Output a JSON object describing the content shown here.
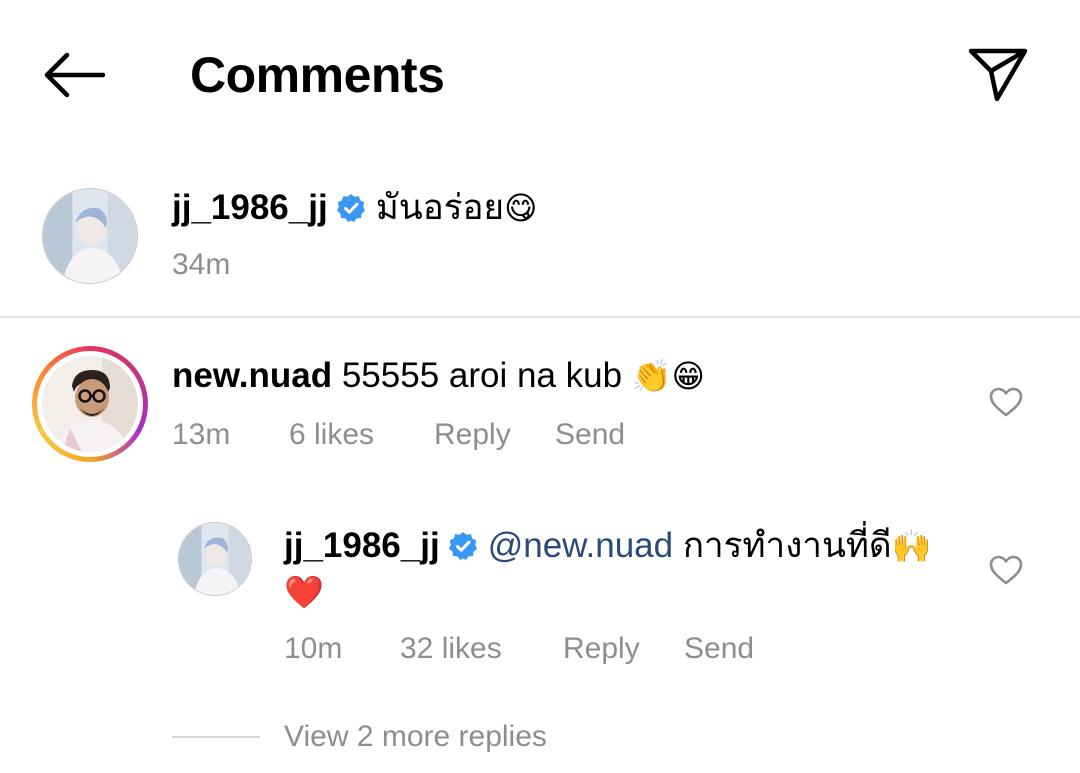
{
  "header": {
    "title": "Comments",
    "back_icon": "arrow-left-icon",
    "send_icon": "paper-plane-icon"
  },
  "caption": {
    "username": "jj_1986_jj",
    "verified": true,
    "text": "มันอร่อย",
    "emoji": "😋",
    "time": "34m"
  },
  "comments": [
    {
      "username": "new.nuad",
      "text": "55555 aroi na kub",
      "emoji": "👏😁",
      "time": "13m",
      "likes": "6 likes",
      "reply_label": "Reply",
      "send_label": "Send",
      "has_story": true,
      "replies": [
        {
          "username": "jj_1986_jj",
          "verified": true,
          "mention": "@new.nuad",
          "text": "การทำงานที่ดี",
          "emoji": "🙌",
          "second_line_emoji": "❤️",
          "time": "10m",
          "likes": "32 likes",
          "reply_label": "Reply",
          "send_label": "Send"
        }
      ],
      "view_more_label": "View 2 more replies"
    }
  ],
  "colors": {
    "verified_blue": "#3897f0",
    "mention": "#2b4a7a",
    "meta_gray": "#8e8e8e",
    "divider": "#e3e3e3"
  }
}
